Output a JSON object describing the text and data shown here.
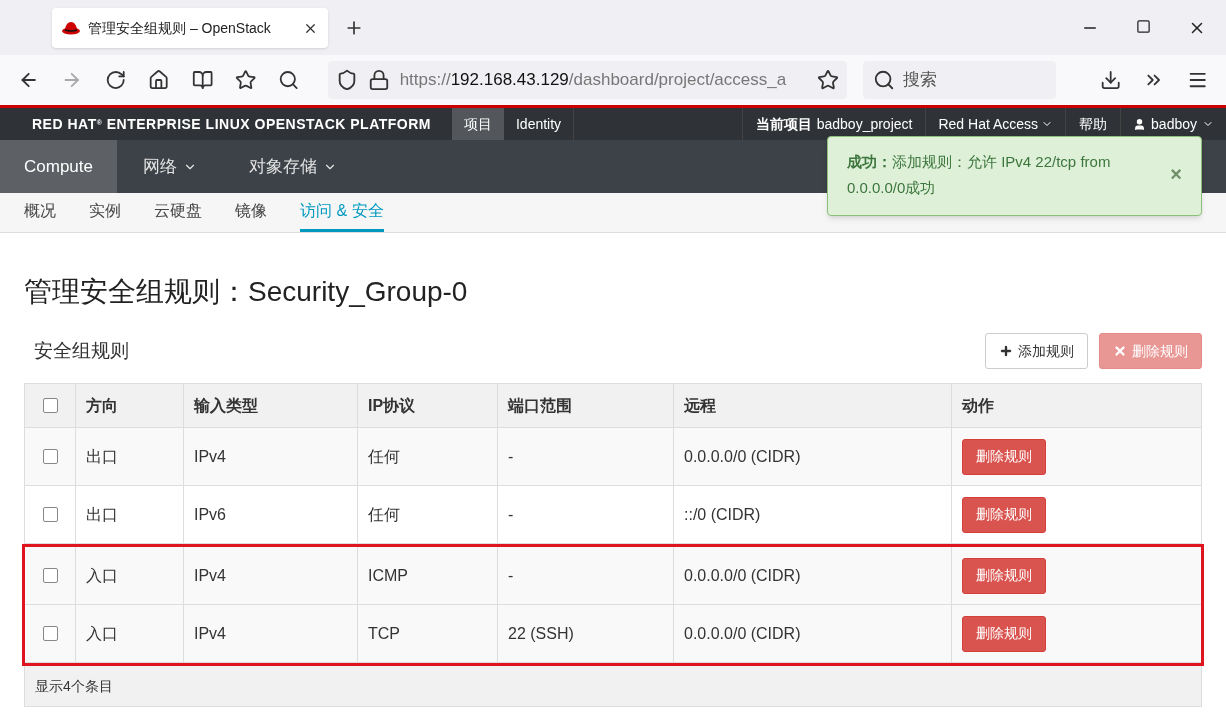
{
  "browser": {
    "tab_title": "管理安全组规则 – OpenStack",
    "url": {
      "scheme": "https://",
      "host": "192.168.43.129",
      "path": "/dashboard/project/access_a"
    },
    "search": {
      "placeholder": "搜索"
    }
  },
  "topbar": {
    "brand": "RED HAT",
    "brand_mark": "®",
    "brand_rest": "ENTERPRISE LINUX OPENSTACK PLATFORM",
    "tabs": [
      {
        "label": "项目",
        "selected": true
      },
      {
        "label": "Identity",
        "selected": false
      }
    ],
    "current_project_label": "当前项目",
    "current_project": "badboy_project",
    "access": "Red Hat Access",
    "help": "帮助",
    "user": "badboy"
  },
  "nav": [
    {
      "label": "Compute",
      "selected": true,
      "dropdown": false
    },
    {
      "label": "网络",
      "selected": false,
      "dropdown": true
    },
    {
      "label": "对象存储",
      "selected": false,
      "dropdown": true
    }
  ],
  "subnav": [
    {
      "label": "概况",
      "selected": false
    },
    {
      "label": "实例",
      "selected": false
    },
    {
      "label": "云硬盘",
      "selected": false
    },
    {
      "label": "镜像",
      "selected": false
    },
    {
      "label": "访问 & 安全",
      "selected": true
    }
  ],
  "alert": {
    "title": "成功：",
    "message": "添加规则：允许 IPv4 22/tcp from 0.0.0.0/0成功",
    "close": "×"
  },
  "page_title": "管理安全组规则：Security_Group-0",
  "section_title": "安全组规则",
  "actions": [
    {
      "label": "添加规则",
      "kind": "add",
      "disabled": false
    },
    {
      "label": "删除规则",
      "kind": "delete",
      "disabled": true
    }
  ],
  "table": {
    "select_all_checked": false,
    "columns": [
      "方向",
      "输入类型",
      "IP协议",
      "端口范围",
      "远程",
      "动作"
    ],
    "rows": [
      {
        "checked": false,
        "highlighted": false,
        "cells": [
          "出口",
          "IPv4",
          "任何",
          "-",
          "0.0.0.0/0 (CIDR)"
        ],
        "action": "删除规则"
      },
      {
        "checked": false,
        "highlighted": false,
        "cells": [
          "出口",
          "IPv6",
          "任何",
          "-",
          "::/0 (CIDR)"
        ],
        "action": "删除规则"
      },
      {
        "checked": false,
        "highlighted": true,
        "cells": [
          "入口",
          "IPv4",
          "ICMP",
          "-",
          "0.0.0.0/0 (CIDR)"
        ],
        "action": "删除规则"
      },
      {
        "checked": false,
        "highlighted": true,
        "cells": [
          "入口",
          "IPv4",
          "TCP",
          "22 (SSH)",
          "0.0.0.0/0 (CIDR)"
        ],
        "action": "删除规则"
      }
    ],
    "footer": "显示4个条目"
  }
}
